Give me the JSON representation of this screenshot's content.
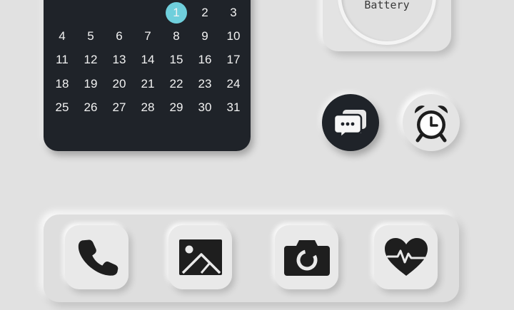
{
  "calendar": {
    "today": "1",
    "weeks": [
      [
        "",
        "",
        "",
        "",
        "1",
        "2",
        "3"
      ],
      [
        "4",
        "5",
        "6",
        "7",
        "8",
        "9",
        "10"
      ],
      [
        "11",
        "12",
        "13",
        "14",
        "15",
        "16",
        "17"
      ],
      [
        "18",
        "19",
        "20",
        "21",
        "22",
        "23",
        "24"
      ],
      [
        "25",
        "26",
        "27",
        "28",
        "29",
        "30",
        "31"
      ]
    ]
  },
  "battery_widget": {
    "label": "Battery"
  },
  "quick_buttons": [
    {
      "name": "messages-button",
      "icon": "chat-bubbles-icon"
    },
    {
      "name": "clock-button",
      "icon": "alarm-clock-icon"
    }
  ],
  "dock": {
    "apps": [
      {
        "name": "phone-app",
        "icon": "phone-icon"
      },
      {
        "name": "photos-app",
        "icon": "image-icon"
      },
      {
        "name": "camera-app",
        "icon": "camera-icon"
      },
      {
        "name": "health-app",
        "icon": "heart-pulse-icon"
      }
    ]
  },
  "colors": {
    "background": "#e1e1e1",
    "dark_tile": "#1f2329",
    "today_highlight": "#6fcfdc",
    "icon_dark": "#1e1e1e"
  }
}
